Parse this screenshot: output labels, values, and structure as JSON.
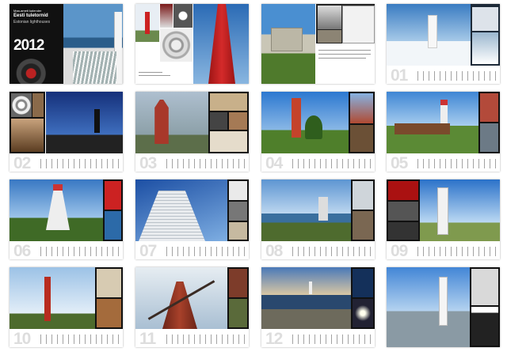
{
  "cover": {
    "publisher": "Maa-ameti kalender",
    "title_et": "Eesti tuletornid",
    "title_en": "Estonian lighthouses",
    "year": "2012"
  },
  "pages": [
    {
      "month": "01"
    },
    {
      "month": "02"
    },
    {
      "month": "03"
    },
    {
      "month": "04"
    },
    {
      "month": "05"
    },
    {
      "month": "06"
    },
    {
      "month": "07"
    },
    {
      "month": "08"
    },
    {
      "month": "09"
    },
    {
      "month": "10"
    },
    {
      "month": "11"
    },
    {
      "month": "12"
    }
  ]
}
